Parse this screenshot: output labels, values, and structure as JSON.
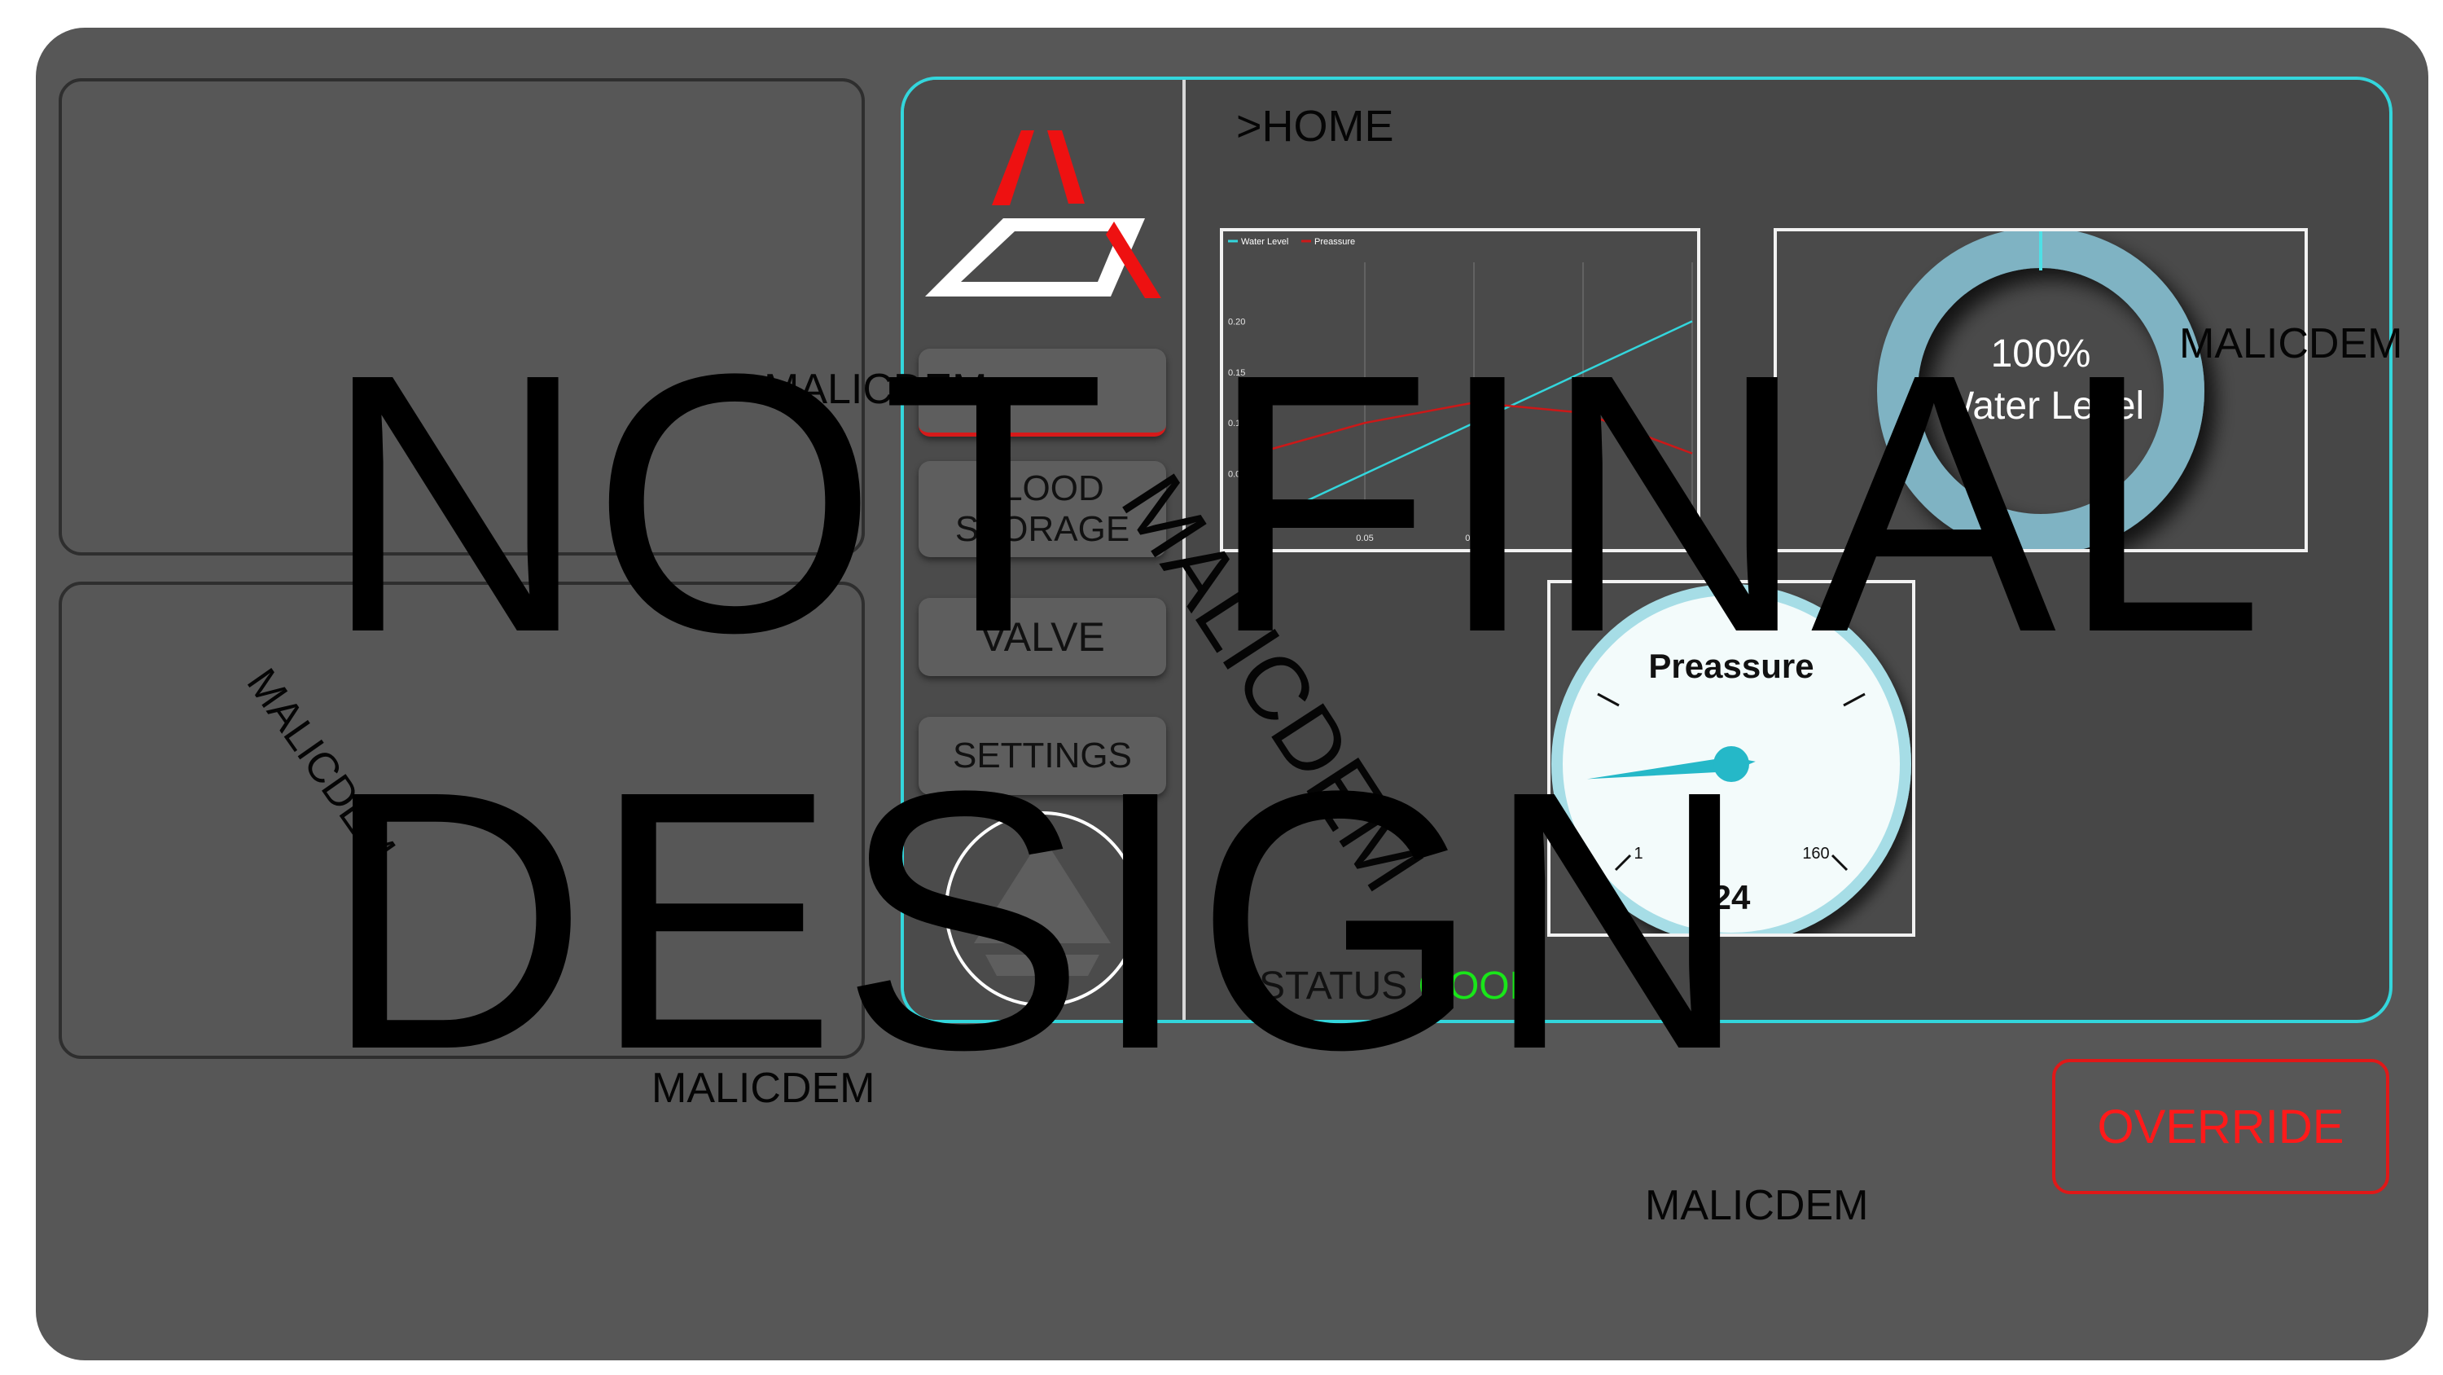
{
  "breadcrumb": ">HOME",
  "nav": {
    "home": "HOME",
    "flood_line1": "FLOOD",
    "flood_line2": "STORAGE",
    "valve": "VALVE",
    "settings": "SETTINGS"
  },
  "status": {
    "label": ">STATUS",
    "value": "GOOD"
  },
  "override_label": "OVERRIDE",
  "watermark_small": "MALICDEM",
  "watermark_big_line1": "NOT FINAL",
  "watermark_big_line2": "DESIGN",
  "water_level": {
    "percent_label": "100%",
    "label": "Water Level",
    "value": 1.0
  },
  "pressure_gauge": {
    "title": "Preassure",
    "value_label": "24",
    "min_label": "1",
    "max_label": "160",
    "value": 24,
    "min": 1,
    "max": 160
  },
  "colors": {
    "accent": "#33d6dc",
    "alert": "#ff1a1a",
    "good": "#19e619",
    "donut": "#7fb3c3"
  },
  "icons": [
    "app-logo-icon",
    "round-logo-icon",
    "gauge-needle-icon"
  ],
  "chart_data": {
    "type": "line",
    "x": [
      0,
      0.05,
      0.1,
      0.15,
      0.2
    ],
    "series": [
      {
        "name": "Water Level",
        "color": "#33d6dc",
        "values": [
          0,
          0.05,
          0.1,
          0.15,
          0.2
        ]
      },
      {
        "name": "Preassure",
        "color": "#cc1818",
        "values": [
          0.07,
          0.1,
          0.12,
          0.11,
          0.07
        ]
      }
    ],
    "xticks": [
      "0.05",
      "0.10",
      "0.15",
      "0.20"
    ],
    "yticks": [
      "0.05",
      "0.10",
      "0.15",
      "0.20"
    ],
    "xlim": [
      0,
      0.2
    ],
    "ylim": [
      0,
      0.25
    ],
    "grid": true,
    "legend": "top-left"
  }
}
